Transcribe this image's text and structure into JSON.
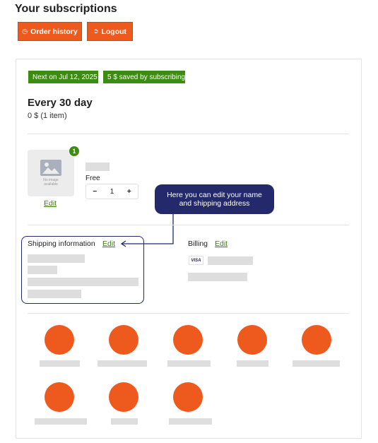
{
  "page": {
    "title": "Your subscriptions"
  },
  "toolbar": {
    "order_history_label": "Order history",
    "logout_label": "Logout",
    "order_history_icon": "clock-icon",
    "logout_icon": "logout-icon"
  },
  "subscription": {
    "next_badge": "Next on Jul 12, 2025",
    "saved_badge": "5 $ saved by subscribing",
    "frequency": "Every 30 day",
    "summary": "0 $ (1 item)",
    "badge_color": "#3e8b12",
    "accent_color": "#ee5a1e"
  },
  "product": {
    "quantity_badge": "1",
    "image_placeholder_text": "No image available",
    "edit_label": "Edit",
    "price": "Free",
    "quantity": "1",
    "decrement_label": "−",
    "increment_label": "+"
  },
  "callout": {
    "line1": "Here you can edit your name",
    "line2": "and shipping address",
    "color": "#23296b"
  },
  "shipping": {
    "label": "Shipping information",
    "edit_label": "Edit"
  },
  "billing": {
    "label": "Billing",
    "edit_label": "Edit",
    "card_brand": "VISA"
  },
  "actions": {
    "count": 8,
    "color": "#ee5a1e"
  }
}
